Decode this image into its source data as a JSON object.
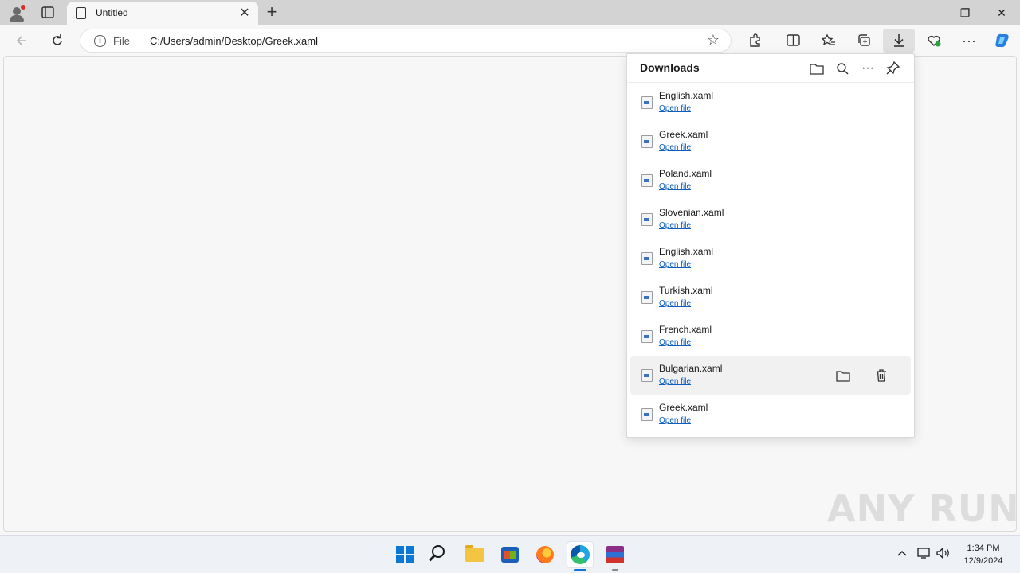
{
  "browser": {
    "tab_title": "Untitled",
    "address": {
      "scheme_label": "File",
      "url": "C:/Users/admin/Desktop/Greek.xaml"
    }
  },
  "downloads": {
    "title": "Downloads",
    "items": [
      {
        "filename": "English.xaml",
        "action": "Open file"
      },
      {
        "filename": "Greek.xaml",
        "action": "Open file"
      },
      {
        "filename": "Poland.xaml",
        "action": "Open file"
      },
      {
        "filename": "Slovenian.xaml",
        "action": "Open file"
      },
      {
        "filename": "English.xaml",
        "action": "Open file"
      },
      {
        "filename": "Turkish.xaml",
        "action": "Open file"
      },
      {
        "filename": "French.xaml",
        "action": "Open file"
      },
      {
        "filename": "Bulgarian.xaml",
        "action": "Open file"
      },
      {
        "filename": "Greek.xaml",
        "action": "Open file"
      }
    ]
  },
  "taskbar": {
    "time": "1:34 PM",
    "date": "12/9/2024"
  },
  "watermark": "ANY RUN",
  "colors": {
    "link": "#0f5ebd",
    "accent": "#0a78d4"
  }
}
